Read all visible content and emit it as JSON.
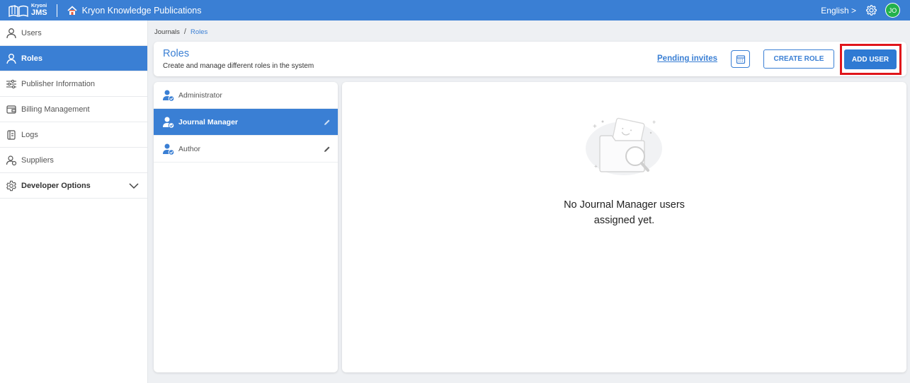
{
  "app": {
    "logo_line1": "Kryoni",
    "logo_line2": "JMS",
    "publisher": "Kryon Knowledge Publications",
    "language": "English",
    "language_arrow": ">",
    "avatar_initials": "JO"
  },
  "sidebar": {
    "items": [
      {
        "label": "Users",
        "icon": "user-icon"
      },
      {
        "label": "Roles",
        "icon": "roles-icon",
        "active": true
      },
      {
        "label": "Publisher Information",
        "icon": "sliders-icon"
      },
      {
        "label": "Billing Management",
        "icon": "wallet-icon"
      },
      {
        "label": "Logs",
        "icon": "notebook-icon"
      },
      {
        "label": "Suppliers",
        "icon": "supplier-icon"
      },
      {
        "label": "Developer Options",
        "icon": "gear-icon"
      }
    ]
  },
  "breadcrumb": {
    "root": "Journals",
    "separator": "/",
    "current": "Roles"
  },
  "header": {
    "title": "Roles",
    "subtitle": "Create and manage different roles in the system",
    "pending_invites": "Pending invites",
    "create_role": "CREATE ROLE",
    "add_user": "ADD USER"
  },
  "roles": [
    {
      "name": "Administrator",
      "editable": false
    },
    {
      "name": "Journal Manager",
      "editable": true,
      "active": true
    },
    {
      "name": "Author",
      "editable": true
    }
  ],
  "empty_state": {
    "line1": "No Journal Manager users",
    "line2": "assigned yet."
  },
  "colors": {
    "primary": "#3a7fd4",
    "highlight": "#e0151b",
    "avatar": "#22b14c"
  }
}
